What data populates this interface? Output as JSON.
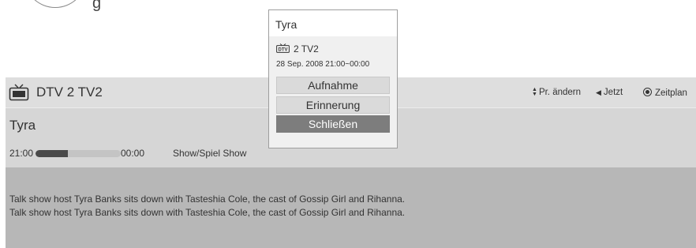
{
  "background_caption": {
    "partial_letter": "g"
  },
  "header": {
    "channel": "DTV 2  TV2",
    "controls": {
      "change_label": "Pr. ändern",
      "now_label": "Jetzt",
      "schedule_label": "Zeitplan"
    }
  },
  "program": {
    "title": "Tyra",
    "start_time": "21:00",
    "end_time": "00:00",
    "progress_fraction": 0.38,
    "genre": "Show/Spiel Show",
    "description": [
      "Talk show host Tyra Banks sits down with Tasteshia Cole, the cast of Gossip Girl and Rihanna.",
      "Talk show host Tyra Banks sits down with Tasteshia Cole, the cast of Gossip Girl and Rihanna."
    ]
  },
  "popup": {
    "title": "Tyra",
    "badge_text": "DTV",
    "channel": "2 TV2",
    "datetime": "28 Sep. 2008 21:00~00:00",
    "buttons": {
      "record": "Aufnahme",
      "reminder": "Erinnerung",
      "close": "Schließen"
    }
  },
  "icons": {
    "tv": "tv-icon",
    "dtv": "dtv-icon",
    "updown": "up-down-arrows-icon",
    "left": "left-arrow-icon",
    "radio": "radio-button-icon"
  },
  "colors": {
    "header_bg": "#dedede",
    "panel_bg": "#d6d6d6",
    "description_bg": "#b7b7b7",
    "selected_button": "#7d7d7d"
  }
}
